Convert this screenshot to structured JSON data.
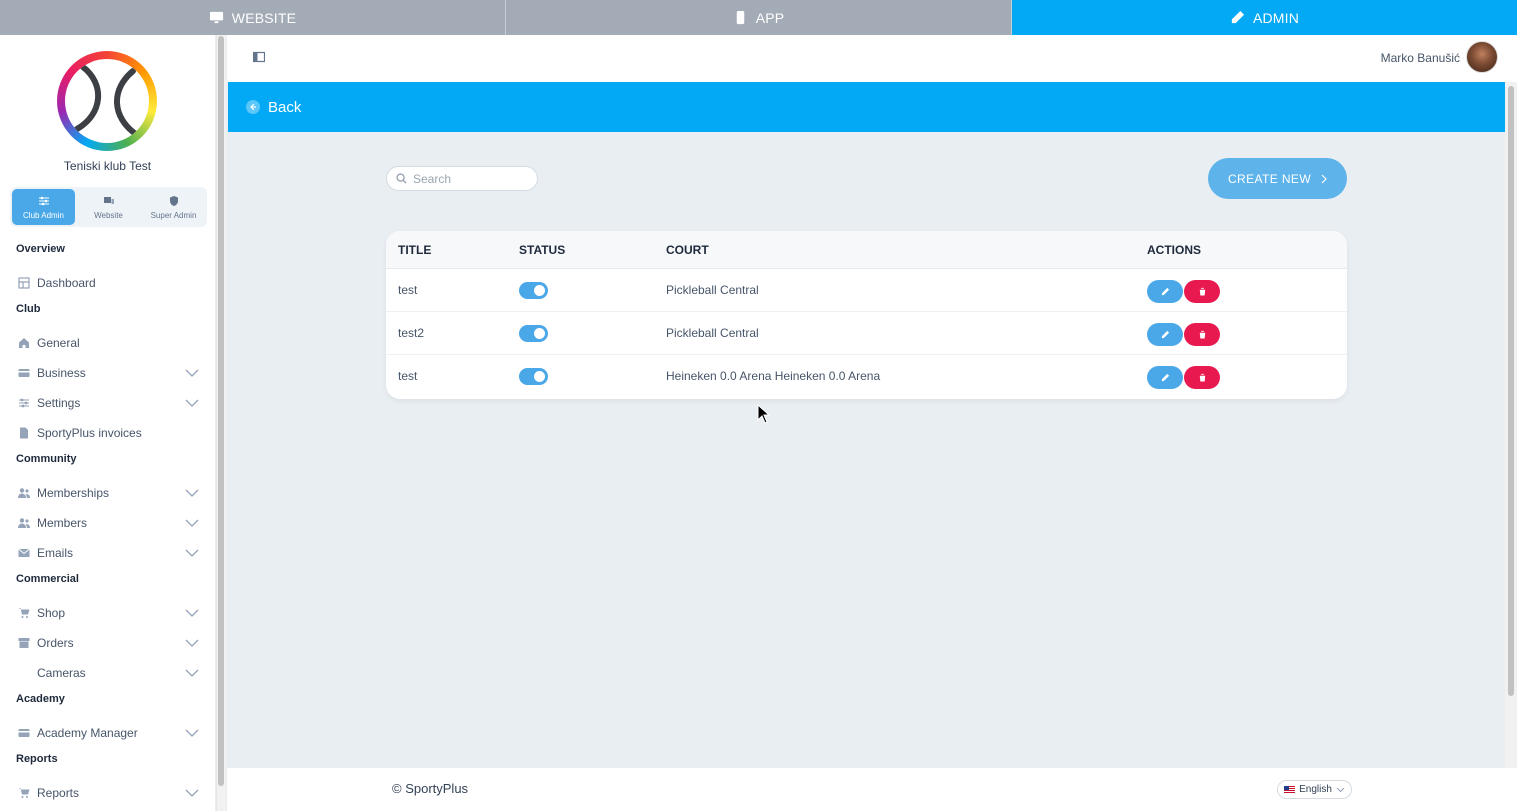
{
  "top_tabs": [
    {
      "label": "WEBSITE",
      "icon": "monitor-icon",
      "active": false
    },
    {
      "label": "APP",
      "icon": "phone-icon",
      "active": false
    },
    {
      "label": "ADMIN",
      "icon": "pencil-icon",
      "active": true
    }
  ],
  "sidebar": {
    "club_name": "Teniski klub Test",
    "roles": [
      {
        "label": "Club Admin",
        "icon": "sliders-icon",
        "active": true
      },
      {
        "label": "Website",
        "icon": "devices-icon",
        "active": false
      },
      {
        "label": "Super Admin",
        "icon": "shield-icon",
        "active": false
      }
    ],
    "sections": {
      "overview": "Overview",
      "club": "Club",
      "community": "Community",
      "commercial": "Commercial",
      "academy": "Academy",
      "reports": "Reports"
    },
    "items": {
      "dashboard": "Dashboard",
      "general": "General",
      "business": "Business",
      "settings": "Settings",
      "invoices": "SportyPlus invoices",
      "memberships": "Memberships",
      "members": "Members",
      "emails": "Emails",
      "shop": "Shop",
      "orders": "Orders",
      "cameras": "Cameras",
      "academy_manager": "Academy Manager",
      "reports": "Reports"
    }
  },
  "header": {
    "user_name": "Marko Banušić"
  },
  "back_bar": {
    "label": "Back"
  },
  "toolbar": {
    "search_placeholder": "Search",
    "create_label": "CREATE NEW"
  },
  "table": {
    "columns": {
      "title": "TITLE",
      "status": "STATUS",
      "court": "COURT",
      "actions": "ACTIONS"
    },
    "rows": [
      {
        "title": "test",
        "status_on": true,
        "court": "Pickleball Central"
      },
      {
        "title": "test2",
        "status_on": true,
        "court": "Pickleball Central"
      },
      {
        "title": "test",
        "status_on": true,
        "court": "Heineken 0.0 Arena Heineken 0.0 Arena"
      }
    ]
  },
  "footer": {
    "copyright": "© SportyPlus",
    "language": "English"
  },
  "colors": {
    "accent": "#03a9f4",
    "toggle": "#4aa8e8",
    "delete": "#e8194f",
    "tab_inactive": "#a3abb6"
  }
}
